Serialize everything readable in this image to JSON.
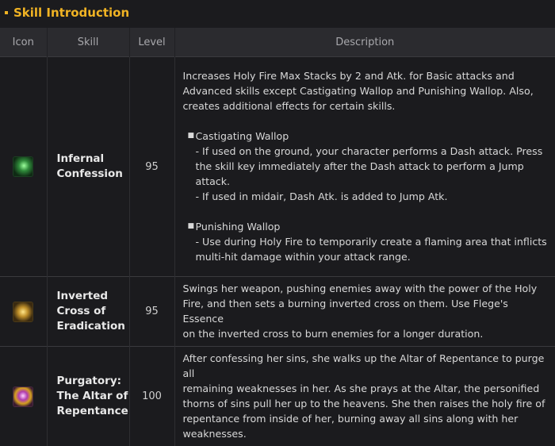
{
  "section": {
    "title": "Skill Introduction"
  },
  "table": {
    "headers": {
      "icon": "Icon",
      "skill": "Skill",
      "level": "Level",
      "description": "Description"
    },
    "rows": [
      {
        "icon": "infernal-confession-skill-icon",
        "skill_line1": "Infernal",
        "skill_line2": "Confession",
        "level": "95",
        "desc": {
          "intro1": "Increases Holy Fire Max Stacks by 2 and Atk. for Basic attacks and",
          "intro2": "Advanced skills except Castigating Wallop and Punishing Wallop. Also,",
          "intro3": "creates additional effects for certain skills.",
          "b1_title": "Castigating Wallop",
          "b1_l1": "- If used on the ground, your character performs a Dash attack. Press",
          "b1_l2": "the skill key immediately after the Dash attack to perform a Jump",
          "b1_l3": "attack.",
          "b1_l4": "- If used in midair, Dash Atk. is added to Jump Atk.",
          "b2_title": "Punishing Wallop",
          "b2_l1": "- Use during Holy Fire to temporarily create a flaming area that inflicts",
          "b2_l2": "multi-hit damage within your attack range."
        }
      },
      {
        "icon": "inverted-cross-skill-icon",
        "skill_line1": "Inverted",
        "skill_line2": "Cross of",
        "skill_line3": "Eradication",
        "level": "95",
        "desc": {
          "l1": "Swings her weapon, pushing enemies away with the power of the Holy",
          "l2": "Fire, and then sets a burning inverted cross on them. Use Flege's Essence",
          "l3": "on the inverted cross to burn enemies for a longer duration."
        }
      },
      {
        "icon": "purgatory-skill-icon",
        "skill_line1": "Purgatory:",
        "skill_line2": "The Altar of",
        "skill_line3": "Repentance",
        "level": "100",
        "desc": {
          "l1": "After confessing her sins, she walks up the Altar of Repentance to purge all",
          "l2": "remaining weaknesses in her. As she prays at the Altar, the personified",
          "l3": "thorns of sins pull her up to the heavens. She then raises the holy fire of",
          "l4": "repentance from inside of her, burning away all sins along with her",
          "l5": "weaknesses."
        }
      }
    ]
  }
}
